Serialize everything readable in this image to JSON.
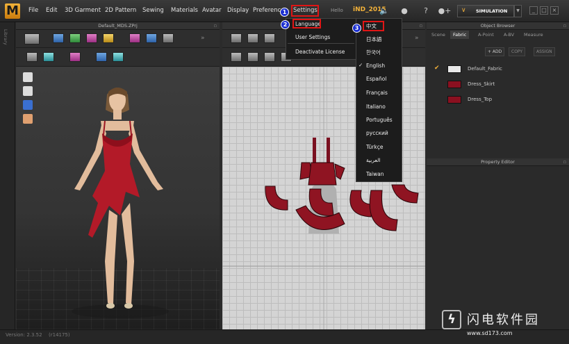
{
  "app": {
    "logo_letter": "M",
    "menu": [
      "File",
      "Edit",
      "3D Garment",
      "2D Pattern",
      "Sewing",
      "Materials",
      "Avatar",
      "Display",
      "Preferenc",
      "Settings"
    ],
    "hello_label": "Hello",
    "username": "iND_2015",
    "simulation_label": "SIMULATION",
    "accent_color": "#f3b23a"
  },
  "library_label": "Library",
  "panels": {
    "view3d_title": "Default_MDS.ZPrj",
    "object_browser_title": "Object Browser",
    "property_editor_title": "Property Editor"
  },
  "object_browser": {
    "tabs": [
      "Scene",
      "Fabric",
      "A-Point",
      "A-BV",
      "Measure"
    ],
    "active_tab": "Fabric",
    "buttons": {
      "add": "+ ADD",
      "copy": "COPY",
      "assign": "ASSIGN"
    },
    "fabrics": [
      {
        "name": "Default_Fabric",
        "color": "#e8e8e8",
        "selected": true
      },
      {
        "name": "Dress_Skirt",
        "color": "#8a1020",
        "selected": false
      },
      {
        "name": "Dress_Top",
        "color": "#8a1020",
        "selected": false
      }
    ]
  },
  "settings_menu": {
    "items": [
      "Language",
      "User Settings",
      "Deactivate License"
    ],
    "highlighted": "Language"
  },
  "language_menu": {
    "items": [
      "中文",
      "日本語",
      "한국어",
      "English",
      "Español",
      "Français",
      "Italiano",
      "Português",
      "русский",
      "Türkçe",
      "العربية",
      "Taiwan"
    ],
    "checked": "English",
    "highlighted": "中文"
  },
  "steps": [
    "1",
    "2",
    "3"
  ],
  "status": {
    "version": "Version: 2.3.52",
    "build": "(r14175)"
  },
  "watermark": {
    "glyph": "ϟ",
    "title": "闪电软件园",
    "url": "www.sd173.com"
  }
}
